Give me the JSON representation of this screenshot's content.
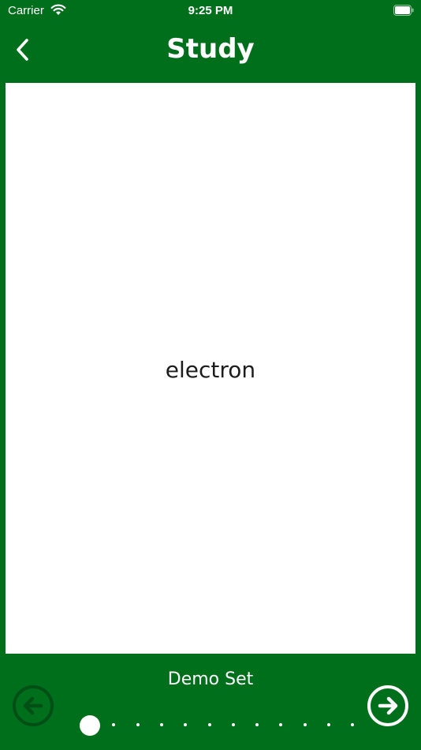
{
  "status_bar": {
    "carrier": "Carrier",
    "time": "9:25 PM"
  },
  "nav": {
    "title": "Study",
    "back_icon": "chevron-left-icon"
  },
  "card": {
    "text": "electron"
  },
  "footer": {
    "set_name": "Demo Set",
    "prev_icon": "arrow-left-circle-icon",
    "next_icon": "arrow-right-circle-icon"
  },
  "pagination": {
    "current_page": 1,
    "total_pages": 12
  },
  "colors": {
    "background": "#006f1c",
    "card": "#ffffff",
    "card_text": "#1c1c1c",
    "disabled": "#004f14"
  }
}
